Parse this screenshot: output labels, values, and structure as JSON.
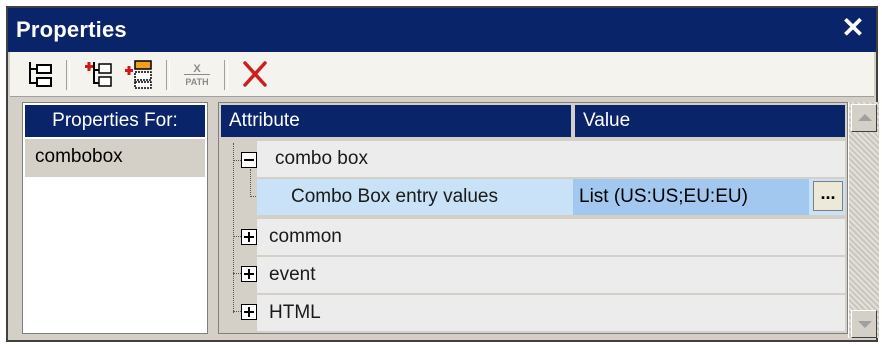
{
  "window": {
    "title": "Properties",
    "close_glyph": "✕"
  },
  "toolbar": {
    "buttons": [
      {
        "name": "tree-view-icon"
      },
      {
        "name": "insert-property-icon"
      },
      {
        "name": "append-property-icon"
      },
      {
        "name": "xpath-icon",
        "text": "X PATH"
      },
      {
        "name": "delete-icon"
      }
    ]
  },
  "left_pane": {
    "header": "Properties For:",
    "items": [
      "combobox"
    ]
  },
  "right_pane": {
    "columns": [
      "Attribute",
      "Value"
    ],
    "rows": [
      {
        "label": "combo box",
        "expander": "minus"
      },
      {
        "label": "Combo Box entry values",
        "value": "List (US:US;EU:EU)",
        "button": "..."
      },
      {
        "label": "common",
        "expander": "plus"
      },
      {
        "label": "event",
        "expander": "plus"
      },
      {
        "label": "HTML",
        "expander": "plus"
      }
    ]
  },
  "colors": {
    "title_bar": "#0a246a",
    "selected_row": "#c9e2f7",
    "value_cell": "#a3c8f0",
    "delete_red": "#cc1f1f"
  }
}
